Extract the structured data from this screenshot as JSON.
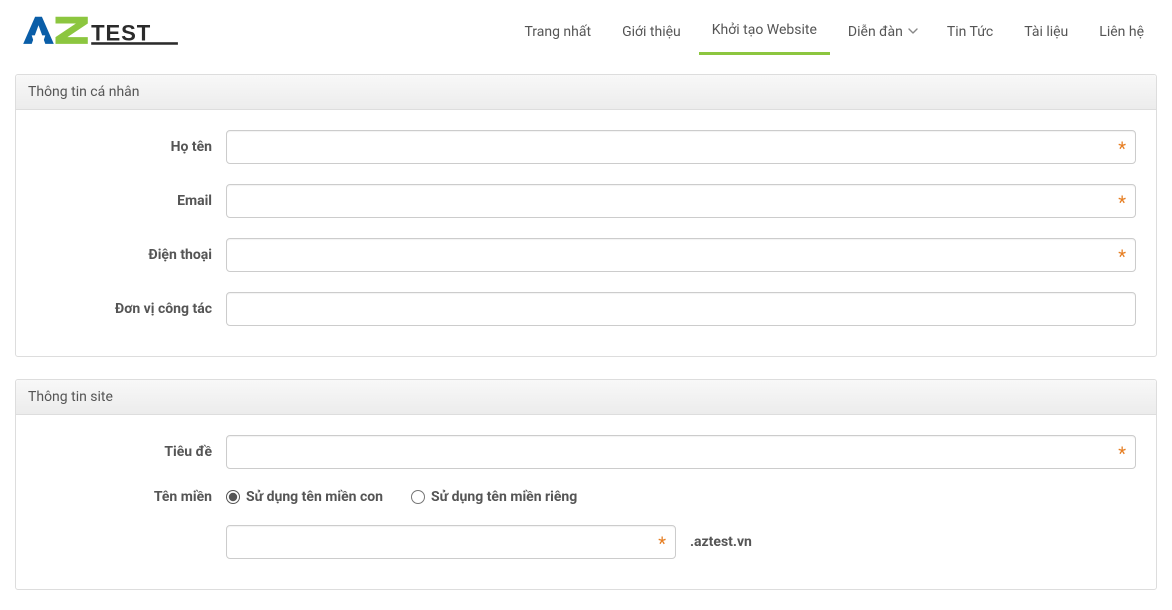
{
  "nav": {
    "items": [
      {
        "label": "Trang nhất"
      },
      {
        "label": "Giới thiệu"
      },
      {
        "label": "Khởi tạo Website"
      },
      {
        "label": "Diễn đàn"
      },
      {
        "label": "Tin Tức"
      },
      {
        "label": "Tài liệu"
      },
      {
        "label": "Liên hệ"
      }
    ]
  },
  "panel_personal": {
    "title": "Thông tin cá nhân",
    "fields": {
      "fullname_label": "Họ tên",
      "email_label": "Email",
      "phone_label": "Điện thoại",
      "org_label": "Đơn vị công tác"
    },
    "required_mark": "*"
  },
  "panel_site": {
    "title": "Thông tin site",
    "fields": {
      "title_label": "Tiêu đề",
      "domain_label": "Tên miền"
    },
    "radio": {
      "subdomain": "Sử dụng tên miền con",
      "owndomain": "Sử dụng tên miền riêng"
    },
    "domain_suffix": ".aztest.vn",
    "required_mark": "*"
  }
}
